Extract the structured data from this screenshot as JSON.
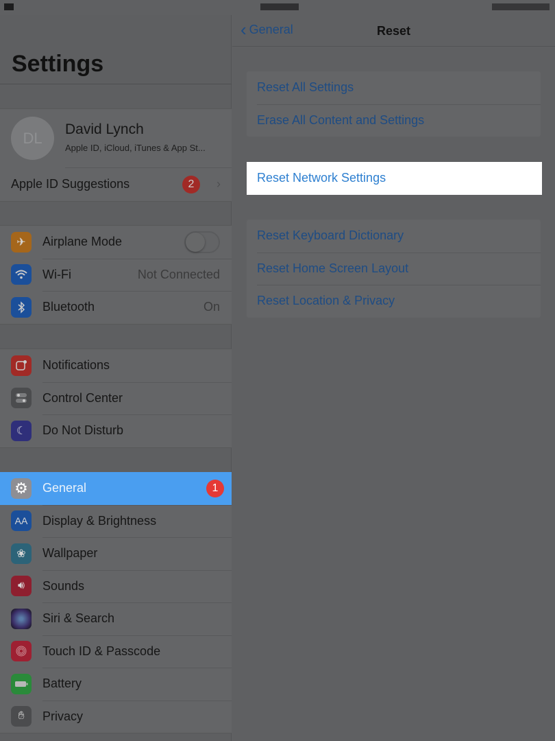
{
  "sidebar": {
    "title": "Settings",
    "profile": {
      "initials": "DL",
      "name": "David Lynch",
      "subtitle": "Apple ID, iCloud, iTunes & App St..."
    },
    "suggestions": {
      "label": "Apple ID Suggestions",
      "badge": "2"
    },
    "group_connectivity": [
      {
        "label": "Airplane Mode",
        "icon": "airplane-icon",
        "toggle_on": false
      },
      {
        "label": "Wi-Fi",
        "icon": "wifi-icon",
        "value": "Not Connected"
      },
      {
        "label": "Bluetooth",
        "icon": "bluetooth-icon",
        "value": "On"
      }
    ],
    "group_notifications": [
      {
        "label": "Notifications",
        "icon": "notifications-icon"
      },
      {
        "label": "Control Center",
        "icon": "control-center-icon"
      },
      {
        "label": "Do Not Disturb",
        "icon": "moon-icon"
      }
    ],
    "group_general": [
      {
        "label": "General",
        "icon": "gear-icon",
        "badge": "1",
        "selected": true
      },
      {
        "label": "Display & Brightness",
        "icon": "display-brightness-icon",
        "glyph": "AA"
      },
      {
        "label": "Wallpaper",
        "icon": "wallpaper-icon"
      },
      {
        "label": "Sounds",
        "icon": "speaker-icon"
      },
      {
        "label": "Siri & Search",
        "icon": "siri-icon"
      },
      {
        "label": "Touch ID & Passcode",
        "icon": "fingerprint-icon"
      },
      {
        "label": "Battery",
        "icon": "battery-icon"
      },
      {
        "label": "Privacy",
        "icon": "hand-icon"
      }
    ]
  },
  "detail": {
    "back_label": "General",
    "title": "Reset",
    "group1": [
      "Reset All Settings",
      "Erase All Content and Settings"
    ],
    "group2": [
      "Reset Network Settings"
    ],
    "group3": [
      "Reset Keyboard Dictionary",
      "Reset Home Screen Layout",
      "Reset Location & Privacy"
    ]
  },
  "colors": {
    "accent_blue": "#4a9ef0",
    "link_blue": "#2d7fd0",
    "badge_red": "#e53935"
  }
}
